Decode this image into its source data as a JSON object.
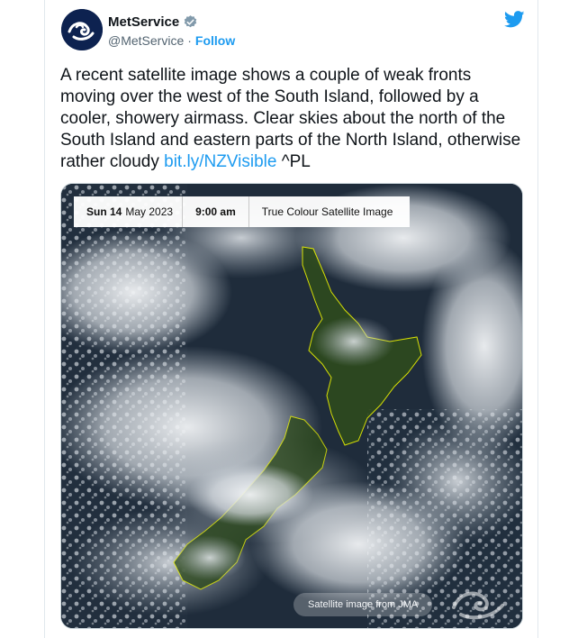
{
  "author": {
    "display_name": "MetService",
    "handle": "@MetService",
    "separator": "·",
    "follow_label": "Follow",
    "verified": true,
    "avatar_icon": "metservice-logo-icon"
  },
  "platform_icon": "twitter-bird-icon",
  "tweet": {
    "text": "A recent satellite image shows a couple of weak fronts moving over the west of the South Island, followed by a cooler, showery airmass. Clear skies about the north of the South Island and eastern parts of the North Island, otherwise rather cloudy",
    "link_text": "bit.ly/NZVisible",
    "signoff": " ^PL"
  },
  "media": {
    "date_day": "Sun 14",
    "date_rest": "May 2023",
    "time": "9:00 am",
    "product": "True Colour Satellite Image",
    "credit": "Satellite image from JMA",
    "watermark_icon": "metservice-watermark-icon"
  },
  "colors": {
    "link": "#1d9bf0",
    "avatar_bg": "#0d2250",
    "ocean": "#1c2a3a",
    "land": "#2e4a1e",
    "coastline": "#e8f000"
  }
}
